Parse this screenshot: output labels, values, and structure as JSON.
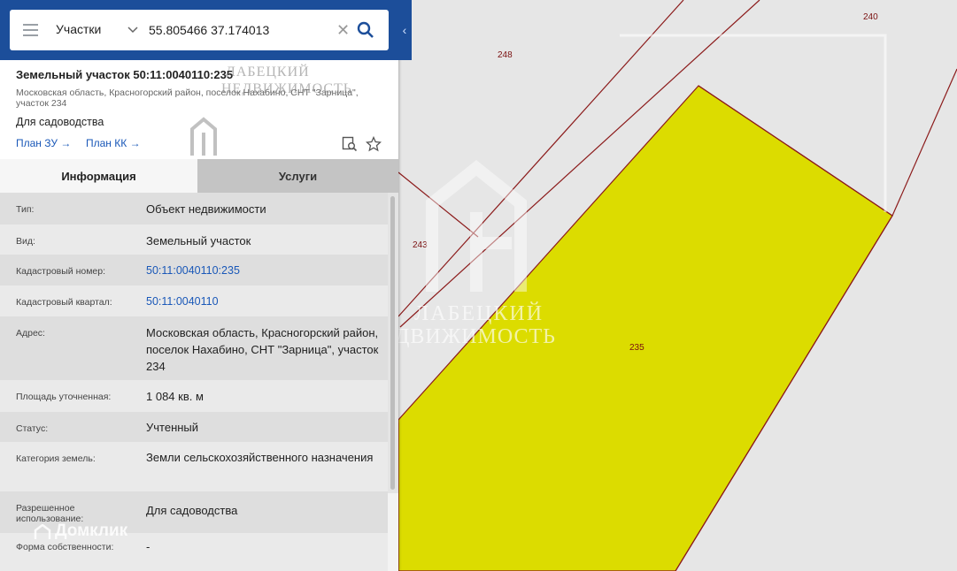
{
  "search": {
    "layer": "Участки",
    "query": "55.805466 37.174013",
    "clear_glyph": "✕"
  },
  "collapse_glyph": "‹",
  "parcel": {
    "title": "Земельный участок 50:11:0040110:235",
    "address_sub": "Московская область, Красногорский район, поселок Нахабино, СНТ \"Зарница\", участок 234",
    "purpose": "Для садоводства",
    "links": {
      "plan_zu": "План ЗУ →",
      "plan_kk": "План КК →"
    }
  },
  "tabs": {
    "info": "Информация",
    "services": "Услуги"
  },
  "rows": [
    {
      "label": "Тип:",
      "value": "Объект недвижимости"
    },
    {
      "label": "Вид:",
      "value": "Земельный участок"
    },
    {
      "label": "Кадастровый номер:",
      "value": "50:11:0040110:235"
    },
    {
      "label": "Кадастровый квартал:",
      "value": "50:11:0040110"
    },
    {
      "label": "Адрес:",
      "value": "Московская область, Красногорский район, поселок Нахабино, СНТ \"Зарница\", участок 234"
    },
    {
      "label": "Площадь уточненная:",
      "value": "1 084 кв. м"
    },
    {
      "label": "Статус:",
      "value": "Учтенный"
    },
    {
      "label": "Категория земель:",
      "value": "Земли сельскохозяйственного назначения"
    },
    {
      "label": "Разрешенное использование:",
      "value": "Для садоводства"
    },
    {
      "label": "Форма собственности:",
      "value": "-"
    }
  ],
  "map": {
    "labels": {
      "p248": "248",
      "p240": "240",
      "p243": "243",
      "p235": "235"
    },
    "colors": {
      "selected_fill": "#dcdc00",
      "boundary": "#8b1a1a",
      "background": "#e6e6e6"
    }
  },
  "watermark": {
    "line1": "ЛАБЕЦКИЙ",
    "line2": "НЕДВИЖИМОСТЬ",
    "brand": "Домклик"
  },
  "icons": {
    "menu": "menu-icon",
    "chevron": "chevron-down-icon",
    "clear": "close-icon",
    "search": "search-icon",
    "collapse": "chevron-left-icon",
    "doc_search": "document-search-icon",
    "favorite": "star-icon"
  }
}
